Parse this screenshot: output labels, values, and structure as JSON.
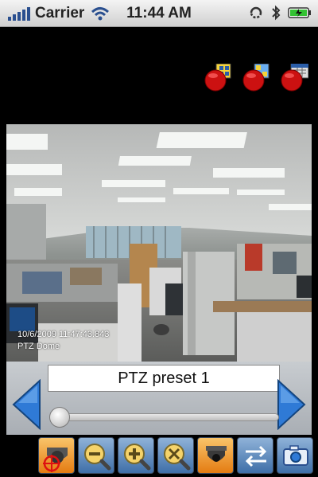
{
  "status_bar": {
    "carrier": "Carrier",
    "time": "11:44 AM"
  },
  "video": {
    "timestamp": "10/6/2009 11:47:43.843",
    "camera_name": "PTZ Dome"
  },
  "controls": {
    "preset_label": "PTZ preset 1",
    "speed_slider_level": 0.0
  },
  "toolbar_icons": [
    "ptz-target-icon",
    "zoom-out-icon",
    "zoom-in-icon",
    "focus-icon",
    "dome-camera-icon",
    "swap-icon",
    "snapshot-icon"
  ],
  "colors": {
    "accent_blue": "#3f6fa8",
    "accent_orange": "#e47c12",
    "record_red": "#cc1111"
  }
}
